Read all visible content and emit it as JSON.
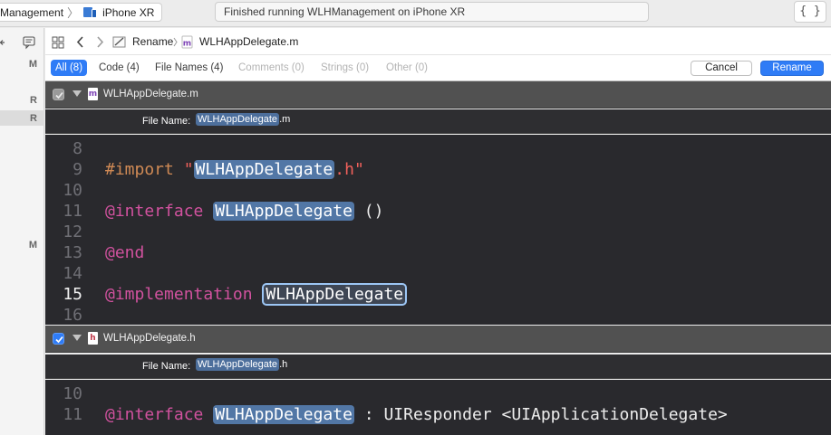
{
  "toolbar": {
    "scheme_name": "Management",
    "device_name": "iPhone XR",
    "activity_status": "Finished running WLHManagement on iPhone XR",
    "braces_label": "{ }"
  },
  "left_strip": {
    "badges": [
      "M",
      "R",
      "R",
      "M"
    ]
  },
  "nav": {
    "breadcrumb_action": "Rename",
    "breadcrumb_file": "WLHAppDelegate.m"
  },
  "filters": {
    "all": "All (8)",
    "code": "Code (4)",
    "file_names": "File Names (4)",
    "comments": "Comments (0)",
    "strings": "Strings (0)",
    "other": "Other (0)"
  },
  "buttons": {
    "cancel": "Cancel",
    "rename": "Rename"
  },
  "file1": {
    "name": "WLHAppDelegate.m",
    "icon_letter": "m",
    "checked": false,
    "file_name_label": "File Name:",
    "file_name_base": "WLHAppDelegate",
    "file_name_ext": ".m",
    "lines": [
      {
        "num": "8"
      },
      {
        "num": "9",
        "pre": "#import ",
        "str_open": "\"",
        "sym": "WLHAppDelegate",
        "str_close": ".h\""
      },
      {
        "num": "10"
      },
      {
        "num": "11",
        "kw": "@interface",
        "sym": "WLHAppDelegate",
        "rest": " ()"
      },
      {
        "num": "12"
      },
      {
        "num": "13",
        "kw": "@end"
      },
      {
        "num": "14"
      },
      {
        "num": "15",
        "kw": "@implementation",
        "sym": "WLHAppDelegate",
        "current": true
      },
      {
        "num": "16"
      }
    ]
  },
  "file2": {
    "name": "WLHAppDelegate.h",
    "icon_letter": "h",
    "checked": true,
    "file_name_label": "File Name:",
    "file_name_base": "WLHAppDelegate",
    "file_name_ext": ".h",
    "lines": [
      {
        "num": "10"
      },
      {
        "num": "11",
        "kw": "@interface",
        "sym": "WLHAppDelegate",
        "rest": " : UIResponder <UIApplicationDelegate>"
      }
    ]
  },
  "colors": {
    "accent": "#2f7cf6",
    "keyword": "#d2529f",
    "preprocessor": "#d08a55",
    "string": "#f1615b",
    "code_background": "#29292d"
  }
}
